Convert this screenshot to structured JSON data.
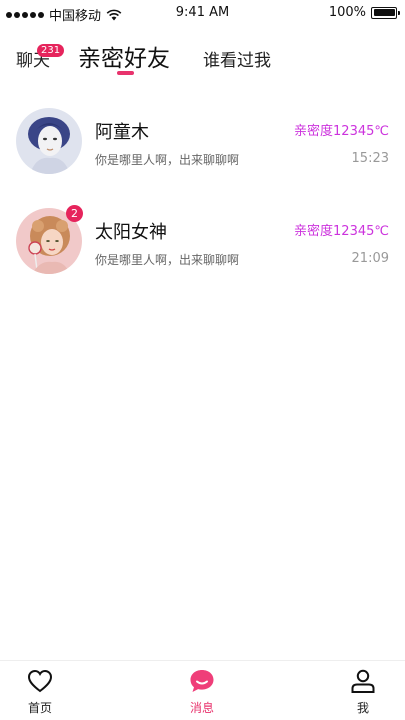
{
  "status_bar": {
    "carrier": "中国移动",
    "time": "9:41 AM",
    "battery": "100%"
  },
  "tabs": {
    "chat": {
      "label": "聊天",
      "badge": "231"
    },
    "friends": {
      "label": "亲密好友"
    },
    "visitors": {
      "label": "谁看过我"
    },
    "active": "friends"
  },
  "conversations": [
    {
      "name": "阿童木",
      "intimacy": "亲密度12345℃",
      "message": "你是哪里人啊，出来聊聊啊",
      "time": "15:23",
      "unread": ""
    },
    {
      "name": "太阳女神",
      "intimacy": "亲密度12345℃",
      "message": "你是哪里人啊，出来聊聊啊",
      "time": "21:09",
      "unread": "2"
    }
  ],
  "tab_bar": {
    "home": {
      "label": "首页",
      "icon": "heart-icon"
    },
    "messages": {
      "label": "消息",
      "icon": "chat-bubble-icon"
    },
    "me": {
      "label": "我",
      "icon": "person-icon"
    },
    "active": "messages"
  },
  "colors": {
    "accent": "#e8336d",
    "badge": "#e6245c",
    "intimacy": "#cc33dd"
  }
}
